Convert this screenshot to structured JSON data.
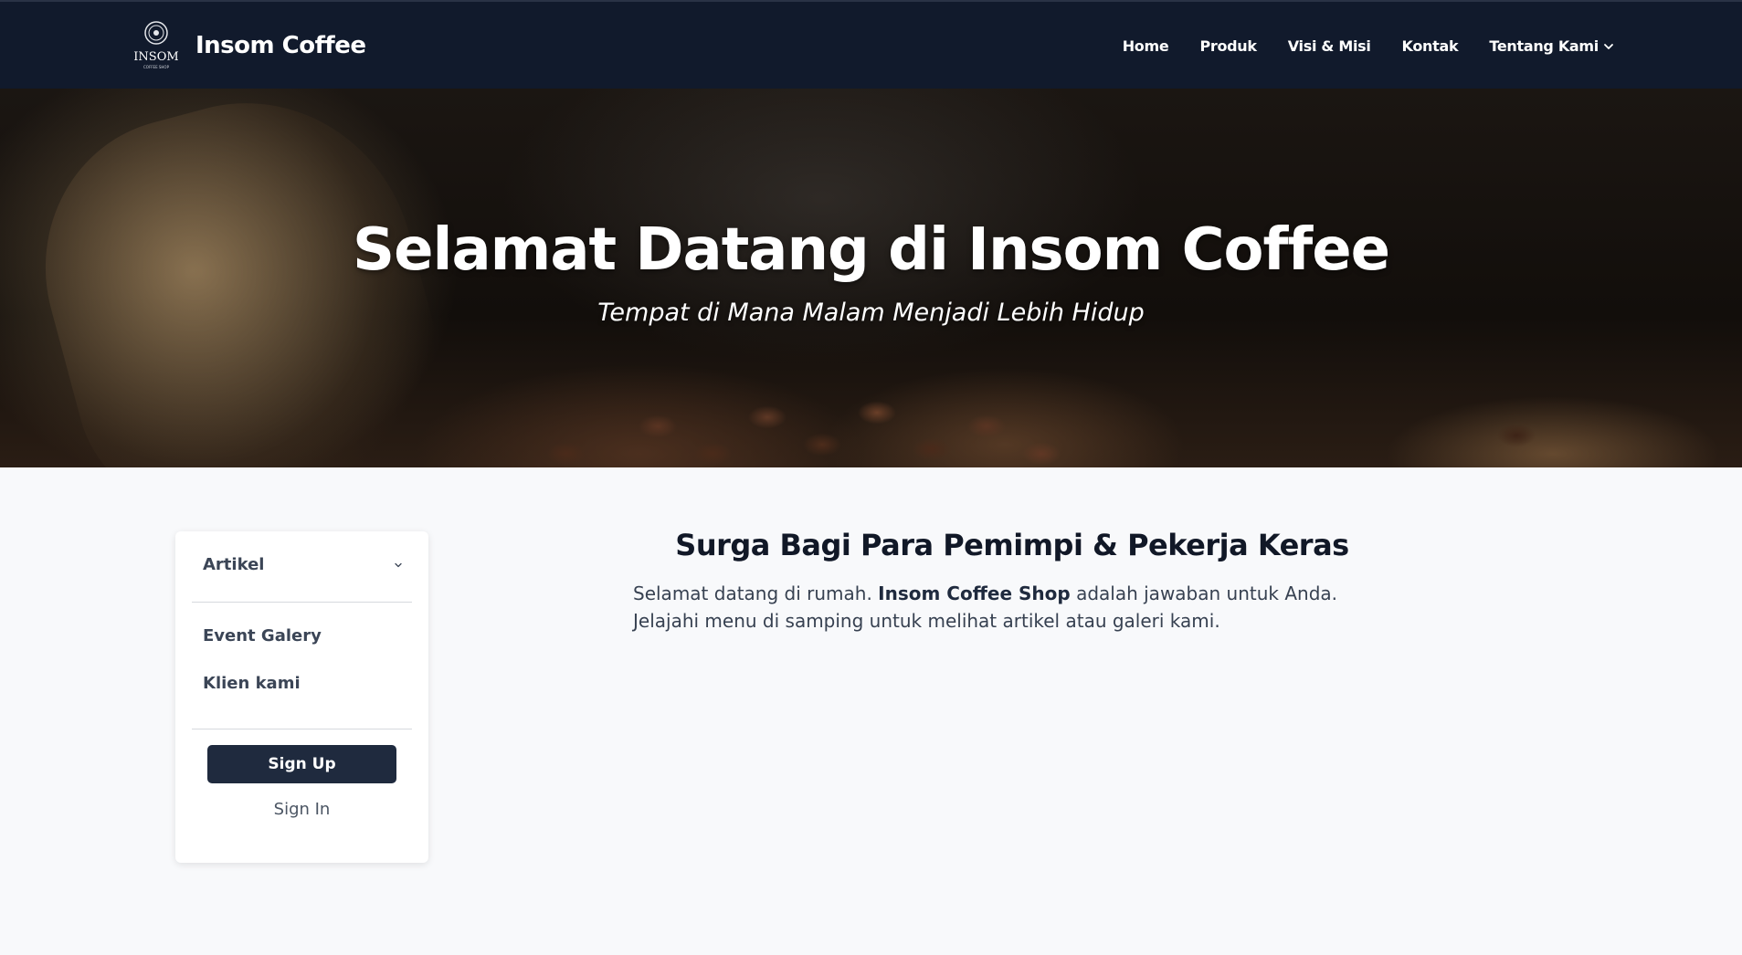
{
  "navbar": {
    "brand": "Insom Coffee",
    "logo_text": "INSOM",
    "logo_subtext": "COFFEE SHOP",
    "links": [
      {
        "label": "Home"
      },
      {
        "label": "Produk"
      },
      {
        "label": "Visi & Misi"
      },
      {
        "label": "Kontak"
      },
      {
        "label": "Tentang Kami",
        "icon": "chevron-down-icon"
      }
    ]
  },
  "hero": {
    "title": "Selamat Datang di Insom Coffee",
    "subtitle": "Tempat di Mana Malam Menjadi Lebih Hidup"
  },
  "sidebar": {
    "artikel": "Artikel",
    "items": [
      {
        "label": "Event Galery"
      },
      {
        "label": "Klien kami"
      }
    ],
    "signup_label": "Sign Up",
    "signin_label": "Sign In"
  },
  "main": {
    "heading": "Surga Bagi Para Pemimpi & Pekerja Keras",
    "text_before": "Selamat datang di rumah. ",
    "text_bold": "Insom Coffee Shop",
    "text_after": " adalah jawaban untuk Anda. Jelajahi menu di samping untuk melihat artikel atau galeri kami."
  },
  "colors": {
    "navbar_bg": "#111a2c",
    "button_bg": "#1f2a3e",
    "page_bg": "#f8f9fb"
  }
}
